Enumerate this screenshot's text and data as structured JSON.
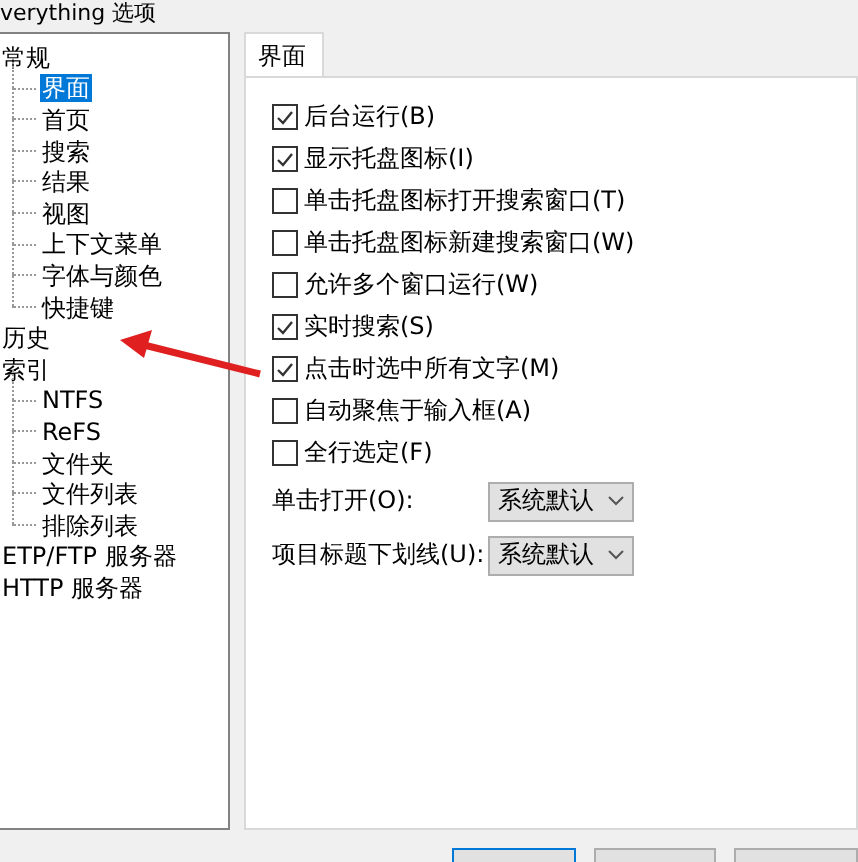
{
  "window": {
    "title": "verything 选项"
  },
  "tree": [
    {
      "label": "常规",
      "selected": false,
      "children": [
        {
          "label": "界面",
          "selected": true
        },
        {
          "label": "首页",
          "selected": false
        },
        {
          "label": "搜索",
          "selected": false
        },
        {
          "label": "结果",
          "selected": false
        },
        {
          "label": "视图",
          "selected": false
        },
        {
          "label": "上下文菜单",
          "selected": false
        },
        {
          "label": "字体与颜色",
          "selected": false
        },
        {
          "label": "快捷键",
          "selected": false
        }
      ]
    },
    {
      "label": "历史",
      "selected": false
    },
    {
      "label": "索引",
      "selected": false,
      "children": [
        {
          "label": "NTFS",
          "selected": false
        },
        {
          "label": "ReFS",
          "selected": false
        },
        {
          "label": "文件夹",
          "selected": false
        },
        {
          "label": "文件列表",
          "selected": false
        },
        {
          "label": "排除列表",
          "selected": false
        }
      ]
    },
    {
      "label": "ETP/FTP 服务器",
      "selected": false
    },
    {
      "label": "HTTP 服务器",
      "selected": false
    }
  ],
  "tabs": [
    {
      "label": "界面",
      "selected": true
    }
  ],
  "options": [
    {
      "label": "后台运行(B)",
      "checked": true
    },
    {
      "label": "显示托盘图标(I)",
      "checked": true
    },
    {
      "label": "单击托盘图标打开搜索窗口(T)",
      "checked": false
    },
    {
      "label": "单击托盘图标新建搜索窗口(W)",
      "checked": false
    },
    {
      "label": "允许多个窗口运行(W)",
      "checked": false
    },
    {
      "label": "实时搜索(S)",
      "checked": true
    },
    {
      "label": "点击时选中所有文字(M)",
      "checked": true
    },
    {
      "label": "自动聚焦于输入框(A)",
      "checked": false
    },
    {
      "label": "全行选定(F)",
      "checked": false
    }
  ],
  "dropdowns": [
    {
      "label": "单击打开(O):",
      "value": "系统默认"
    },
    {
      "label": "项目标题下划线(U):",
      "value": "系统默认"
    }
  ]
}
